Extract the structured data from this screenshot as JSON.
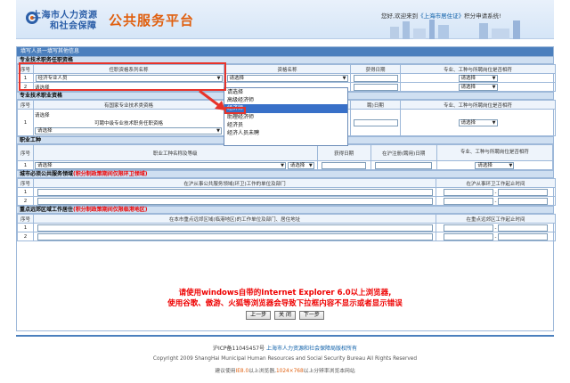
{
  "header": {
    "logo_line1": "上海市人力资源",
    "logo_line2": "和社会保障",
    "site_title": "公共服务平台",
    "welcome_prefix": "您好,欢迎来到",
    "welcome_site": "《上海市居住证》",
    "welcome_suffix": "积分申请系统!"
  },
  "frame": {
    "title": "填写人员一填写其他信息"
  },
  "sec1": {
    "title": "专业技术职务任职资格",
    "headers": [
      "序号",
      "任职资格系列名称",
      "资格名称",
      "获得日期",
      "专业、工种与所聘岗位是否相符"
    ],
    "rows": [
      {
        "no": "1",
        "series": "经济专业人员",
        "qual": "请选择",
        "match": "请选择"
      },
      {
        "no": "2",
        "series": "请选择",
        "qual": "",
        "match": "请选择"
      }
    ]
  },
  "dropdown": {
    "items": [
      "请选择",
      "高级经济师",
      "经济师",
      "助理经济师",
      "经济员",
      "经济人员未聘"
    ],
    "selected_index": 2
  },
  "sec2": {
    "title": "专业技术职业资格",
    "headers": [
      "序号",
      "有国家专业技术类资格",
      "聘)日期",
      "专业、工种与所聘岗位是否相符"
    ],
    "row": {
      "no": "1",
      "sel1": "请选择",
      "text": "可聘中级专业技术职务任职资格",
      "sel2": "请选择",
      "match": "请选择"
    }
  },
  "sec3": {
    "title": "职业工种",
    "headers": [
      "序号",
      "职业工种名称及等级",
      "获得日期",
      "在沪注册(聘用)日期",
      "专业、工种与所聘岗位是否相符"
    ],
    "row": {
      "no": "1",
      "name": "请选择",
      "level": "请选择",
      "match": "请选择"
    }
  },
  "sec4": {
    "title": "城市必须公共服务领域",
    "note": "(积分制政策期间仅限环卫领域)",
    "headers": [
      "序号",
      "在沪从事公共服务领域(环卫)工作的单位及部门",
      "在沪从事环卫工作起止时间"
    ],
    "rows": [
      "1",
      "2"
    ],
    "dash": "-"
  },
  "sec5": {
    "title": "重点远郊区域工作居住",
    "note": "(积分制政策期间仅限临港地区)",
    "headers": [
      "序号",
      "在本市重点远郊区域(临港地区)的工作单位及部门、居住地址",
      "在重点远郊区工作起止时间"
    ],
    "rows": [
      "1",
      "2"
    ],
    "dash": "-"
  },
  "notice": {
    "line1": "请使用windows自带的Internet Explorer 6.0以上浏览器,",
    "line2": "使用谷歌、傲游、火狐等浏览器会导致下拉框内容不显示或者显示错误"
  },
  "buttons": {
    "prev": "上一步",
    "close": "关 闭",
    "next": "下一步"
  },
  "footer": {
    "icp": "沪ICP备11045457号",
    "owner": "上海市人力资源和社会保障局版权所有",
    "copyright": "Copyright 2009 ShangHai Municipal Human Resources and Social Security Bureau All Rights Reserved",
    "tip_prefix": "建议使用",
    "tip_ie": "IE8.0",
    "tip_mid": "以上浏览器,",
    "tip_res": "1024×768",
    "tip_suffix": "以上分辨率浏览本网站"
  },
  "colors": {
    "accent": "#4b7fbd",
    "highlight": "#e8332a",
    "selected": "#3870c8",
    "title_orange": "#e06010"
  }
}
